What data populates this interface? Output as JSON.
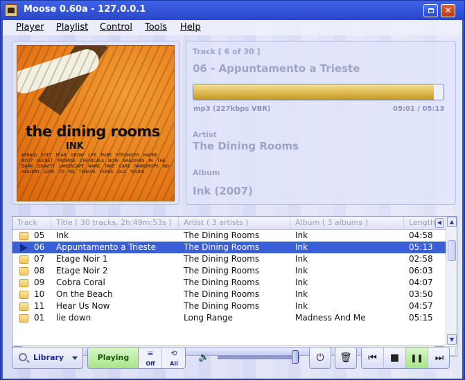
{
  "window": {
    "title": "Moose 0.60a - 127.0.0.1"
  },
  "menu": [
    "Player",
    "Playlist",
    "Control",
    "Tools",
    "Help"
  ],
  "album_art": {
    "title": "the dining rooms",
    "subtitle": "INK",
    "scribble": "AFRAID SOFT FEAR GROW LIFE PURE STRONGER MAYBE NOT? SECRET PROMISE CHEMICALS NOW SHADOWS IN THE DARK GRAVITY LANDSCAPE NAME TAKE CARE RAINDROPS NO HOLIDAY LOVE TO ME TWELVE YEARS OLD YOURS"
  },
  "now_playing": {
    "track_label": "Track [ 6 of 30 ]",
    "track_title": "06 - Appuntamento a Trieste",
    "progress_fraction": 0.962,
    "format": "mp3 (227kbps VBR)",
    "time": "05:01 / 05:13",
    "artist_label": "Artist",
    "artist": "The Dining Rooms",
    "album_label": "Album",
    "album": "Ink (2007)"
  },
  "playlist": {
    "headers": [
      "Track",
      "Title ( 30 tracks, 2h:49m:53s )",
      "Artist ( 3 artists )",
      "Album ( 3 albums )",
      "Length"
    ],
    "rows": [
      {
        "track": "05",
        "title": "Ink",
        "artist": "The Dining Rooms",
        "album": "Ink",
        "length": "04:58",
        "selected": false
      },
      {
        "track": "06",
        "title": "Appuntamento a Trieste",
        "artist": "The Dining Rooms",
        "album": "Ink",
        "length": "05:13",
        "selected": true
      },
      {
        "track": "07",
        "title": "Etage Noir 1",
        "artist": "The Dining Rooms",
        "album": "Ink",
        "length": "02:58",
        "selected": false
      },
      {
        "track": "08",
        "title": "Etage Noir 2",
        "artist": "The Dining Rooms",
        "album": "Ink",
        "length": "06:03",
        "selected": false
      },
      {
        "track": "09",
        "title": "Cobra Coral",
        "artist": "The Dining Rooms",
        "album": "Ink",
        "length": "04:07",
        "selected": false
      },
      {
        "track": "10",
        "title": "On the Beach",
        "artist": "The Dining Rooms",
        "album": "Ink",
        "length": "03:50",
        "selected": false
      },
      {
        "track": "11",
        "title": "Hear Us Now",
        "artist": "The Dining Rooms",
        "album": "Ink",
        "length": "04:57",
        "selected": false
      },
      {
        "track": "01",
        "title": "lie down",
        "artist": "Long Range",
        "album": "Madness And Me",
        "length": "05:15",
        "selected": false
      }
    ]
  },
  "toolbar": {
    "library_label": "Library",
    "playing_label": "Playing",
    "shuffle_label": "Off",
    "repeat_label": "All",
    "volume_fraction": 0.95
  },
  "icons": {
    "speaker": "🔊",
    "power": "⏻",
    "trash": "🗑",
    "prev": "⏮",
    "stop": "■",
    "pause": "❚❚",
    "next": "⏭"
  },
  "colors": {
    "selection": "#3a5ed8",
    "titlebar": "#2a47c7",
    "progress": "#e3c162",
    "playing": "#a9e58a"
  }
}
